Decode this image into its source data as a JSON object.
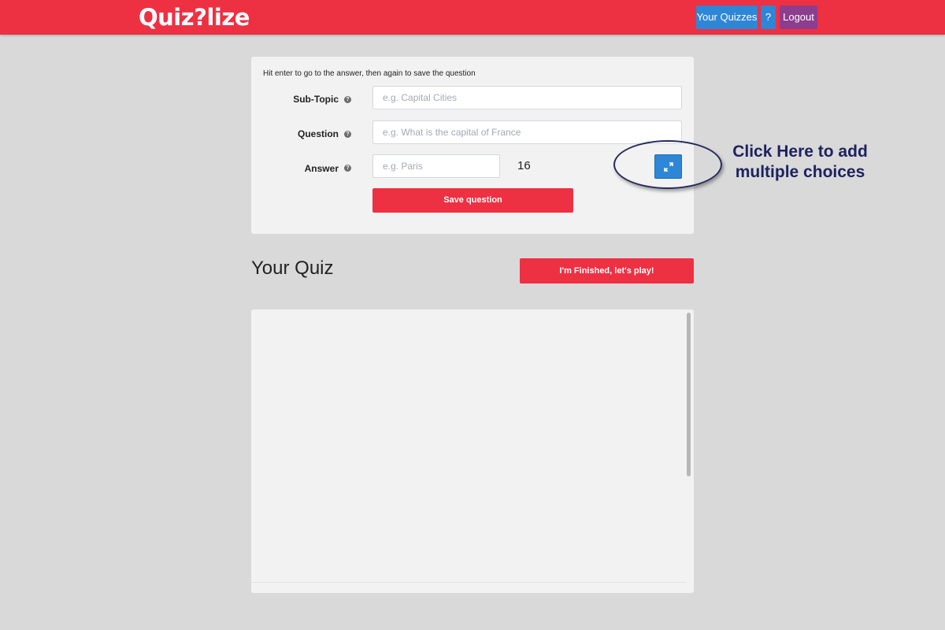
{
  "app": {
    "logo_text": "Quiz?lize"
  },
  "nav": {
    "your_quizzes": "Your Quizzes",
    "help": "?",
    "logout": "Logout"
  },
  "form": {
    "hint": "Hit enter to go to the answer, then again to save the question",
    "subtopic_label": "Sub-Topic",
    "subtopic_placeholder": "e.g. Capital Cities",
    "question_label": "Question",
    "question_placeholder": "e.g. What is the capital of France",
    "answer_label": "Answer",
    "answer_placeholder": "e.g. Paris",
    "answer_count": "16",
    "save_label": "Save question"
  },
  "annotation": {
    "text": "Click Here to add multiple choices"
  },
  "quiz": {
    "title": "Your Quiz",
    "finish_label": "I'm Finished, let's play!"
  },
  "colors": {
    "brand_red": "#ee3043",
    "accent_blue": "#2e86d6",
    "logout_purple": "#8c3d8e",
    "background": "#d9d9d9",
    "panel": "#f2f2f2"
  },
  "icons": {
    "info": "question-circle-icon",
    "expand": "expand-arrows-icon"
  }
}
